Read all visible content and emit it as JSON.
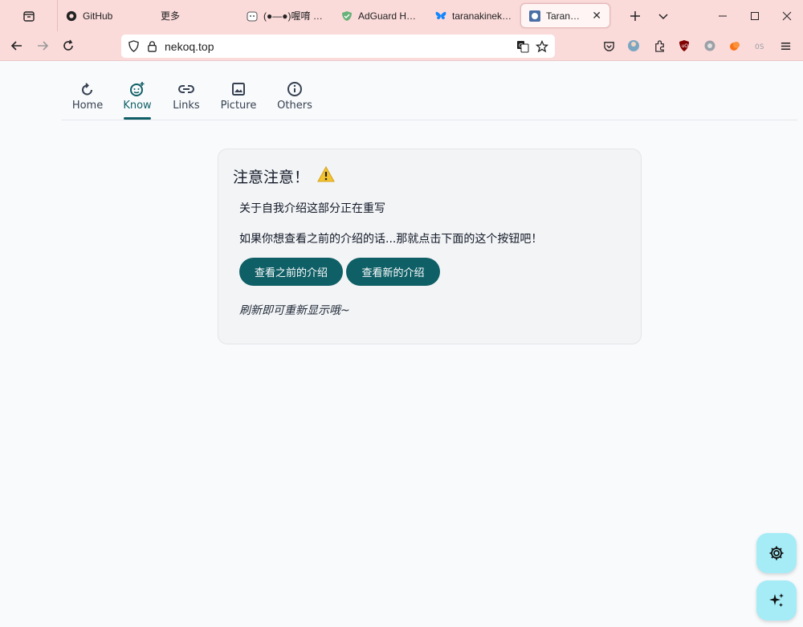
{
  "browser": {
    "tabs": [
      {
        "title": "GitHub",
        "icon": "github-icon"
      },
      {
        "title": "更多",
        "icon": ""
      },
      {
        "title": "(●—●)喔唷 · 趣",
        "icon": "cat-icon"
      },
      {
        "title": "AdGuard Home",
        "icon": "adguard-shield-icon"
      },
      {
        "title": "taranakineko (@",
        "icon": "bluesky-butterfly-icon"
      },
      {
        "title": "Taranakineko",
        "icon": "site-favicon",
        "active": true
      }
    ],
    "url": "nekoq.top"
  },
  "site_nav": {
    "items": [
      {
        "label": "Home",
        "icon": "refresh-icon"
      },
      {
        "label": "Know",
        "icon": "face-sparkle-icon",
        "active": true
      },
      {
        "label": "Links",
        "icon": "link-icon"
      },
      {
        "label": "Picture",
        "icon": "image-icon"
      },
      {
        "label": "Others",
        "icon": "info-icon"
      }
    ]
  },
  "card": {
    "title": "注意注意！",
    "title_emoji": "⚠️",
    "line1": "关于自我介绍这部分正在重写",
    "line2": "如果你想查看之前的介绍的话...那就点击下面的这个按钮吧！",
    "btn_old": "查看之前的介绍",
    "btn_new": "查看新的介绍",
    "note": "刷新即可重新显示哦~"
  },
  "fabs": {
    "settings": "gear-icon",
    "ai": "sparkle-icon"
  },
  "colors": {
    "chrome_bg": "#fbdada",
    "accent": "#0f5f66",
    "fab_bg": "#a5ecf7",
    "card_bg": "#f3f4f6"
  }
}
